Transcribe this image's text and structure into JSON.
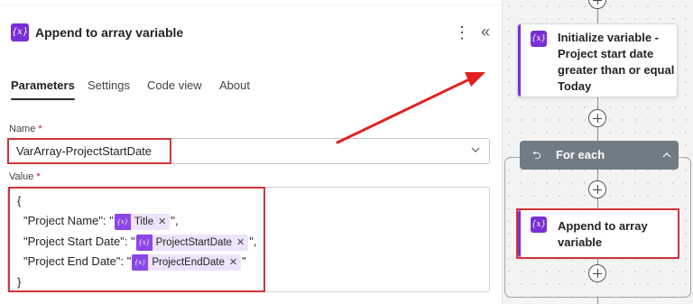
{
  "panel": {
    "title": "Append to array variable",
    "icon": "variable-icon",
    "more_label": "⋮",
    "collapse_label": "«"
  },
  "tabs": [
    {
      "label": "Parameters",
      "active": true
    },
    {
      "label": "Settings",
      "active": false
    },
    {
      "label": "Code view",
      "active": false
    },
    {
      "label": "About",
      "active": false
    }
  ],
  "form": {
    "name_label": "Name",
    "value_label": "Value",
    "required_mark": "*",
    "name_value": "VarArray-ProjectStartDate",
    "value_lines": {
      "open": "{",
      "line1_prefix": "\"Project Name\": \"",
      "line1_token": "Title",
      "line1_suffix": "\",",
      "line2_prefix": "\"Project Start Date\": \"",
      "line2_token": "ProjectStartDate",
      "line2_suffix": "\",",
      "line3_prefix": "\"Project End Date\": \"",
      "line3_token": "ProjectEndDate",
      "line3_suffix": "\"",
      "close": "}"
    },
    "token_icon_text": "{x}",
    "token_remove": "✕"
  },
  "flow": {
    "init_card_title": "Initialize variable - Project start date greater than or equal Today",
    "init_title_lines": [
      "Initialize variable -",
      "Project start date",
      "greater than or equal",
      "Today"
    ],
    "foreach_label": "For each",
    "foreach_icon": "⮌",
    "append_title_lines": [
      "Append to array",
      "variable"
    ],
    "icon_text": "{x}"
  },
  "colors": {
    "accent_purple": "#7a2ed6",
    "highlight_red": "#d13438",
    "foreach_header": "#6f7c85",
    "arrow_red": "#e0211d"
  }
}
